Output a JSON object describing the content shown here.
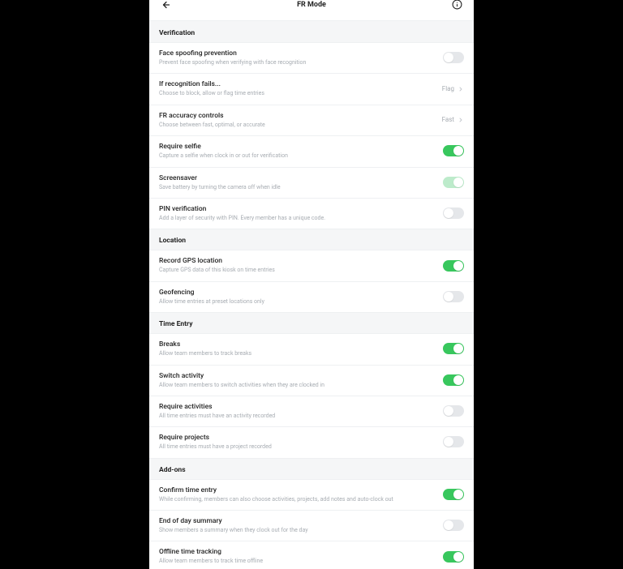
{
  "header": {
    "title": "FR Mode"
  },
  "sections": {
    "verification": {
      "heading": "Verification",
      "items": {
        "faceSpoof": {
          "label": "Face spoofing prevention",
          "desc": "Prevent face spoofing when verifying with face recognition"
        },
        "ifFails": {
          "label": "If recognition fails...",
          "desc": "Choose to block, allow or flag time entries",
          "value": "Flag"
        },
        "accuracy": {
          "label": "FR accuracy controls",
          "desc": "Choose between fast, optimal, or accurate",
          "value": "Fast"
        },
        "selfie": {
          "label": "Require selfie",
          "desc": "Capture a selfie when clock in or out for verification"
        },
        "screensaver": {
          "label": "Screensaver",
          "desc": "Save battery by turning the camera off when idle"
        },
        "pin": {
          "label": "PIN verification",
          "desc": "Add a layer of security with PIN. Every member has a unique code."
        }
      }
    },
    "location": {
      "heading": "Location",
      "items": {
        "gps": {
          "label": "Record GPS location",
          "desc": "Capture GPS data of this kiosk on time entries"
        },
        "geofence": {
          "label": "Geofencing",
          "desc": "Allow time entries at preset locations only"
        }
      }
    },
    "timeEntry": {
      "heading": "Time Entry",
      "items": {
        "breaks": {
          "label": "Breaks",
          "desc": "Allow team members to track breaks"
        },
        "switchAct": {
          "label": "Switch activity",
          "desc": "Allow team members to switch activities when they are clocked in"
        },
        "reqAct": {
          "label": "Require activities",
          "desc": "All time entries must have an activity recorded"
        },
        "reqProj": {
          "label": "Require projects",
          "desc": "All time entries must have a project recorded"
        }
      }
    },
    "addons": {
      "heading": "Add-ons",
      "items": {
        "confirm": {
          "label": "Confirm time entry",
          "desc": "While confirming, members can also choose activities, projects, add notes and auto-clock out"
        },
        "eodSummary": {
          "label": "End of day summary",
          "desc": "Show members a summary when they clock out for the day"
        },
        "offline": {
          "label": "Offline time tracking",
          "desc": "Allow team members to track time offline"
        }
      }
    }
  },
  "toggles": {
    "faceSpoof": false,
    "selfie": true,
    "screensaver": "faded-on",
    "pin": false,
    "gps": true,
    "geofence": false,
    "breaks": true,
    "switchAct": true,
    "reqAct": false,
    "reqProj": false,
    "confirm": true,
    "eodSummary": false,
    "offline": true
  }
}
